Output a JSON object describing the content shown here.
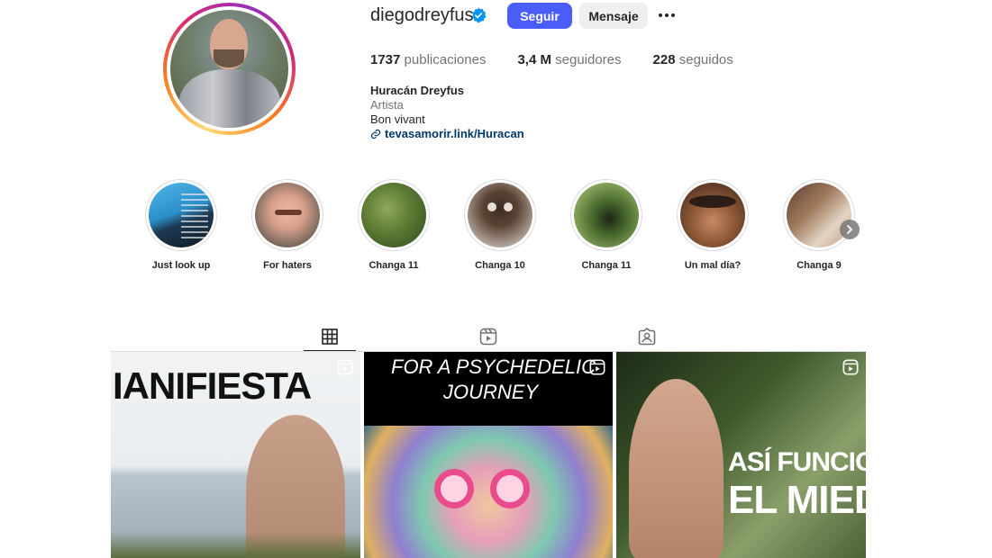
{
  "profile": {
    "username": "diegodreyfus",
    "follow_label": "Seguir",
    "message_label": "Mensaje",
    "stats": [
      {
        "value": "1737",
        "label": "publicaciones"
      },
      {
        "value": "3,4 M",
        "label": "seguidores"
      },
      {
        "value": "228",
        "label": "seguidos"
      }
    ],
    "bio": {
      "name": "Huracán Dreyfus",
      "category": "Artista",
      "text": "Bon vivant",
      "link": "tevasamorir.link/Huracan"
    }
  },
  "highlights": [
    {
      "label": "Just look up"
    },
    {
      "label": "For haters"
    },
    {
      "label": "Changa 11"
    },
    {
      "label": "Changa 10"
    },
    {
      "label": "Changa 11"
    },
    {
      "label": "Un mal día?"
    },
    {
      "label": "Changa 9"
    }
  ],
  "tabs": [
    {
      "name": "posts",
      "icon": "grid-icon",
      "active": true
    },
    {
      "name": "reels",
      "icon": "reels-icon",
      "active": false
    },
    {
      "name": "tagged",
      "icon": "tagged-icon",
      "active": false
    }
  ],
  "posts": [
    {
      "title": "IANIFIESTA",
      "icon": "reel-icon"
    },
    {
      "title_line1": "FOR A PSYCHEDELIC",
      "title_line2": "JOURNEY",
      "icon": "reel-icon"
    },
    {
      "title_line1": "ASÍ FUNCION",
      "title_line2": "EL MIED",
      "icon": "reel-icon"
    }
  ],
  "colors": {
    "accent": "#4a5df9",
    "link": "#00376b",
    "muted": "#737373",
    "verified": "#0095f6"
  }
}
